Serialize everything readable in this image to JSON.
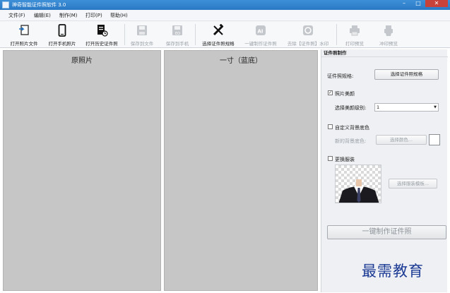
{
  "window": {
    "title": "神奇智能证件照软件 3.0",
    "min_symbol": "–",
    "max_symbol": "□",
    "close_symbol": "✕"
  },
  "menu": [
    {
      "label": "文件(F)"
    },
    {
      "label": "编辑(E)"
    },
    {
      "label": "制作(M)"
    },
    {
      "label": "打印(P)"
    },
    {
      "label": "帮助(H)"
    }
  ],
  "toolbar": [
    {
      "label": "打开照片文件",
      "icon": "open-file-icon",
      "enabled": true
    },
    {
      "label": "打开手机照片",
      "icon": "phone-icon",
      "enabled": true
    },
    {
      "label": "打开历史证件照",
      "icon": "history-icon",
      "enabled": true
    },
    {
      "label": "保存到文件",
      "icon": "save-icon",
      "enabled": false
    },
    {
      "label": "保存到手机",
      "icon": "save-phone-icon",
      "enabled": false
    },
    {
      "label": "选择证件照规格",
      "icon": "ruler-icon",
      "enabled": true
    },
    {
      "label": "一键制作证件照",
      "icon": "ai-icon",
      "enabled": false
    },
    {
      "label": "去除【证件照】水印",
      "icon": "remove-watermark-icon",
      "enabled": false
    },
    {
      "label": "打印预览",
      "icon": "printer-icon",
      "enabled": false
    },
    {
      "label": "冲印预览",
      "icon": "print-service-icon",
      "enabled": false
    }
  ],
  "panels": {
    "original_title": "原照片",
    "result_title": "一寸（蓝底）"
  },
  "side": {
    "header": "证件照制作",
    "spec_label": "证件照规格:",
    "spec_button": "选择证件照规格",
    "beauty_checkbox": "照片美颜",
    "beauty_checked": true,
    "beauty_level_label": "选择美颜级别:",
    "beauty_level_value": "1",
    "custom_bg_checkbox": "自定义背景底色",
    "custom_bg_checked": false,
    "new_bg_label": "新的背景底色:",
    "choose_color_button": "选择颜色...",
    "bg_color": "#ffffff",
    "change_clothes_checkbox": "更换服装",
    "change_clothes_checked": false,
    "choose_clothes_button": "选择服装模板...",
    "make_button": "一键制作证件照"
  },
  "watermark": "最需教育",
  "colors": {
    "titlebar": "#2a78c4",
    "panel_bg": "#c6c6c6",
    "watermark": "#1c3b95"
  }
}
